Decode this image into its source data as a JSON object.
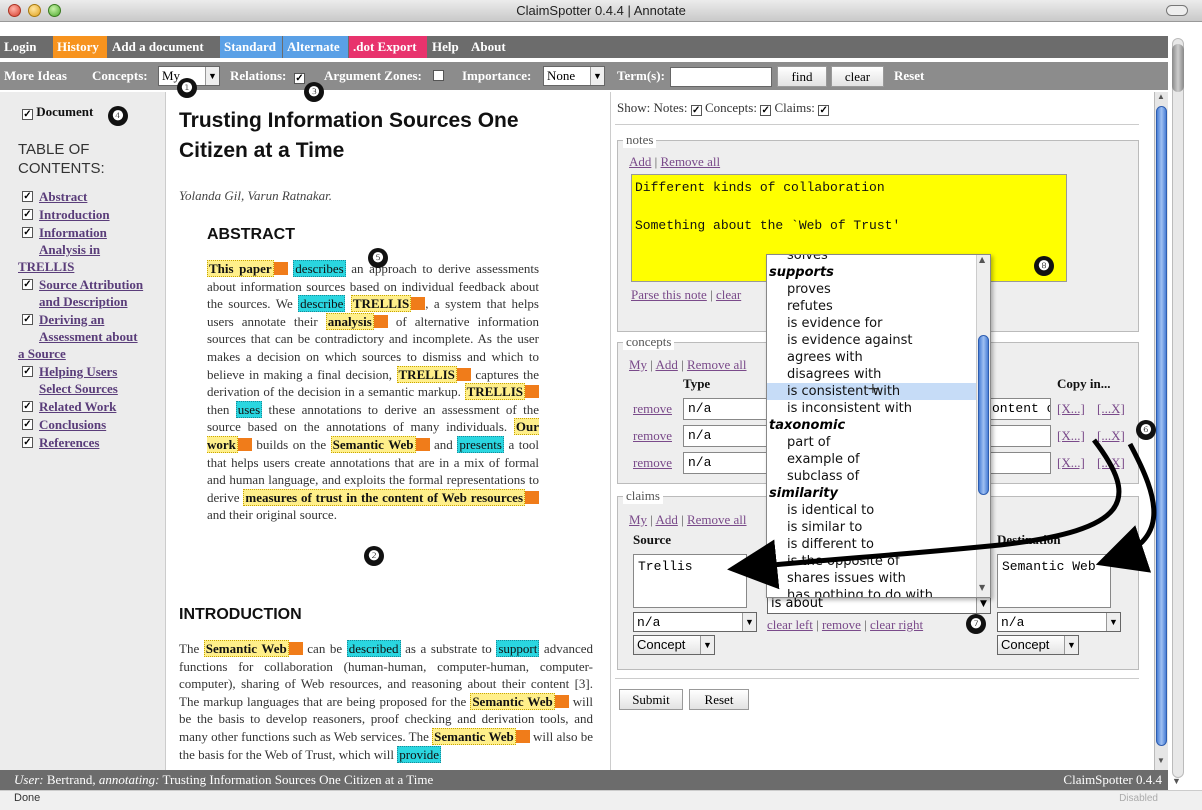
{
  "window": {
    "title": "ClaimSpotter 0.4.4 | Annotate"
  },
  "menu": [
    {
      "label": "Login",
      "color": "#6c6c6c"
    },
    {
      "label": "History",
      "color": "#f7931e"
    },
    {
      "label": "Add a document",
      "color": "#6c6c6c"
    },
    {
      "label": "Standard",
      "color": "#5aa0e6"
    },
    {
      "label": "Alternate",
      "color": "#5aa0e6"
    },
    {
      "label": ".dot Export",
      "color": "#e8336d"
    },
    {
      "label": "Help",
      "color": "#6c6c6c"
    },
    {
      "label": "About",
      "color": "#6c6c6c"
    }
  ],
  "toolbar": {
    "more_ideas": "More Ideas",
    "concepts_label": "Concepts:",
    "concepts_value": "My",
    "relations_label": "Relations:",
    "relations_checked": true,
    "zones_label": "Argument Zones:",
    "zones_checked": false,
    "importance_label": "Importance:",
    "importance_value": "None",
    "terms_label": "Term(s):",
    "terms_value": "",
    "find_label": "find",
    "clear_label": "clear",
    "reset_label": "Reset"
  },
  "badges": [
    "❶",
    "❷",
    "❸",
    "❹",
    "❺",
    "❻",
    "❼",
    "❽"
  ],
  "sidebar": {
    "document_label": "Document",
    "toc_title_1": "TABLE OF",
    "toc_title_2": "CONTENTS:",
    "items": [
      {
        "lines": [
          "Abstract"
        ]
      },
      {
        "lines": [
          "Introduction"
        ]
      },
      {
        "lines": [
          "Information",
          "Analysis in",
          "TRELLIS"
        ]
      },
      {
        "lines": [
          "Source Attribution",
          "and Description"
        ]
      },
      {
        "lines": [
          "Deriving an",
          "Assessment about",
          "a Source"
        ]
      },
      {
        "lines": [
          "Helping Users",
          "Select Sources"
        ]
      },
      {
        "lines": [
          "Related Work"
        ]
      },
      {
        "lines": [
          "Conclusions"
        ]
      },
      {
        "lines": [
          "References"
        ]
      }
    ]
  },
  "document": {
    "title_1": "Trusting Information Sources One",
    "title_2": "Citizen at a Time",
    "authors": "Yolanda Gil, Varun Ratnakar.",
    "abstract_heading": "ABSTRACT",
    "intro_heading": "INTRODUCTION",
    "abstract_segments": [
      {
        "t": "This paper",
        "k": "c"
      },
      {
        "t": " ",
        "k": "p"
      },
      {
        "t": "describes",
        "k": "r"
      },
      {
        "t": " an approach to derive assessments about information sources based on individual feedback about the sources. We ",
        "k": "p"
      },
      {
        "t": "describe",
        "k": "r"
      },
      {
        "t": " ",
        "k": "p"
      },
      {
        "t": "TRELLIS",
        "k": "c"
      },
      {
        "t": ", a system that helps users annotate their ",
        "k": "p"
      },
      {
        "t": "analysis",
        "k": "c"
      },
      {
        "t": " of alternative information sources that can be contradictory and incomplete. As the user makes a decision on which sources to dismiss and which to believe in making a final decision, ",
        "k": "p"
      },
      {
        "t": "TRELLIS",
        "k": "c"
      },
      {
        "t": " captures the derivation of the decision in a semantic markup. ",
        "k": "p"
      },
      {
        "t": "TRELLIS",
        "k": "c"
      },
      {
        "t": " then ",
        "k": "p"
      },
      {
        "t": "uses",
        "k": "r"
      },
      {
        "t": " these annotations to derive an assessment of the source based on the annotations of many individuals. ",
        "k": "p"
      },
      {
        "t": "Our work",
        "k": "c"
      },
      {
        "t": " builds on the ",
        "k": "p"
      },
      {
        "t": "Semantic Web",
        "k": "c"
      },
      {
        "t": " and ",
        "k": "p"
      },
      {
        "t": "presents",
        "k": "r"
      },
      {
        "t": " a tool that helps users create annotations that are in a mix of formal and human language, and exploits the formal representations to derive ",
        "k": "p"
      },
      {
        "t": "measures of trust in the content of Web resources",
        "k": "c"
      },
      {
        "t": " and their original source.",
        "k": "p"
      }
    ],
    "intro_segments": [
      {
        "t": "The ",
        "k": "p"
      },
      {
        "t": "Semantic Web",
        "k": "c"
      },
      {
        "t": " can be ",
        "k": "p"
      },
      {
        "t": "described",
        "k": "r"
      },
      {
        "t": " as a substrate to ",
        "k": "p"
      },
      {
        "t": "support",
        "k": "r"
      },
      {
        "t": " advanced functions for collaboration (human-human, computer-human, computer-computer), sharing of Web resources, and reasoning about their content [3]. The markup languages that are being proposed for the ",
        "k": "p"
      },
      {
        "t": "Semantic Web",
        "k": "c"
      },
      {
        "t": " will be the basis to develop reasoners, proof checking and derivation tools, and many other functions such as Web services. The ",
        "k": "p"
      },
      {
        "t": "Semantic Web",
        "k": "c"
      },
      {
        "t": " will also be the basis for the Web of Trust, which will ",
        "k": "p"
      },
      {
        "t": "provide",
        "k": "r"
      }
    ]
  },
  "panel": {
    "show_label": "Show:",
    "show_notes": "Notes:",
    "show_concepts": "Concepts:",
    "show_claims": "Claims:",
    "notes": {
      "legend": "notes",
      "add": "Add",
      "remove_all": "Remove all",
      "text_1": "Different kinds of collaboration",
      "text_2": "Something about the `Web of Trust'",
      "parse": "Parse this note",
      "clear": "clear"
    },
    "concepts": {
      "legend": "concepts",
      "my": "My",
      "add": "Add",
      "remove_all": "Remove all",
      "type_header": "Type",
      "copy_header": "Copy in...",
      "rows": [
        {
          "remove": "remove",
          "type": "n/a",
          "content": "ontent o",
          "copy_left": "[X...]",
          "copy_right": "[...X]"
        },
        {
          "remove": "remove",
          "type": "n/a",
          "content": "",
          "copy_left": "[X...]",
          "copy_right": "[...X]"
        },
        {
          "remove": "remove",
          "type": "n/a",
          "content": "",
          "copy_left": "[X...]",
          "copy_right": "[...X]"
        }
      ]
    },
    "claims": {
      "legend": "claims",
      "my": "My",
      "add": "Add",
      "remove_all": "Remove all",
      "source_header": "Source",
      "dest_header": "Destination",
      "source_text": "Trellis",
      "dest_text": "Semantic Web",
      "source_type": "n/a",
      "dest_type": "n/a",
      "source_kind": "Concept",
      "dest_kind": "Concept",
      "relation_value": "is about",
      "clear_left": "clear left",
      "remove": "remove",
      "clear_right": "clear right"
    },
    "submit": "Submit",
    "reset": "Reset"
  },
  "relation_list": [
    {
      "t": "solves",
      "g": false
    },
    {
      "t": "supports",
      "g": true
    },
    {
      "t": "proves",
      "g": false
    },
    {
      "t": "refutes",
      "g": false
    },
    {
      "t": "is evidence for",
      "g": false
    },
    {
      "t": "is evidence against",
      "g": false
    },
    {
      "t": "agrees with",
      "g": false
    },
    {
      "t": "disagrees with",
      "g": false
    },
    {
      "t": "is consistent with",
      "g": false,
      "sel": true
    },
    {
      "t": "is inconsistent with",
      "g": false
    },
    {
      "t": "taxonomic",
      "g": true
    },
    {
      "t": "part of",
      "g": false
    },
    {
      "t": "example of",
      "g": false
    },
    {
      "t": "subclass of",
      "g": false
    },
    {
      "t": "similarity",
      "g": true
    },
    {
      "t": "is identical to",
      "g": false
    },
    {
      "t": "is similar to",
      "g": false
    },
    {
      "t": "is different to",
      "g": false
    },
    {
      "t": "is the opposite of",
      "g": false
    },
    {
      "t": "shares issues with",
      "g": false
    },
    {
      "t": "has nothing to do with",
      "g": false
    }
  ],
  "status": {
    "user_label": "User:",
    "user_name": "Bertrand,",
    "annotating_label": "annotating:",
    "doc_title": "Trusting Information Sources One Citizen at a Time",
    "version": "ClaimSpotter 0.4.4",
    "done": "Done",
    "disabled": "Disabled"
  },
  "colors": {
    "concept_highlight": "#ffef8a",
    "relation_highlight": "#2ad6e0",
    "marker_orange": "#f07c1a",
    "note_yellow": "#ffff00"
  }
}
